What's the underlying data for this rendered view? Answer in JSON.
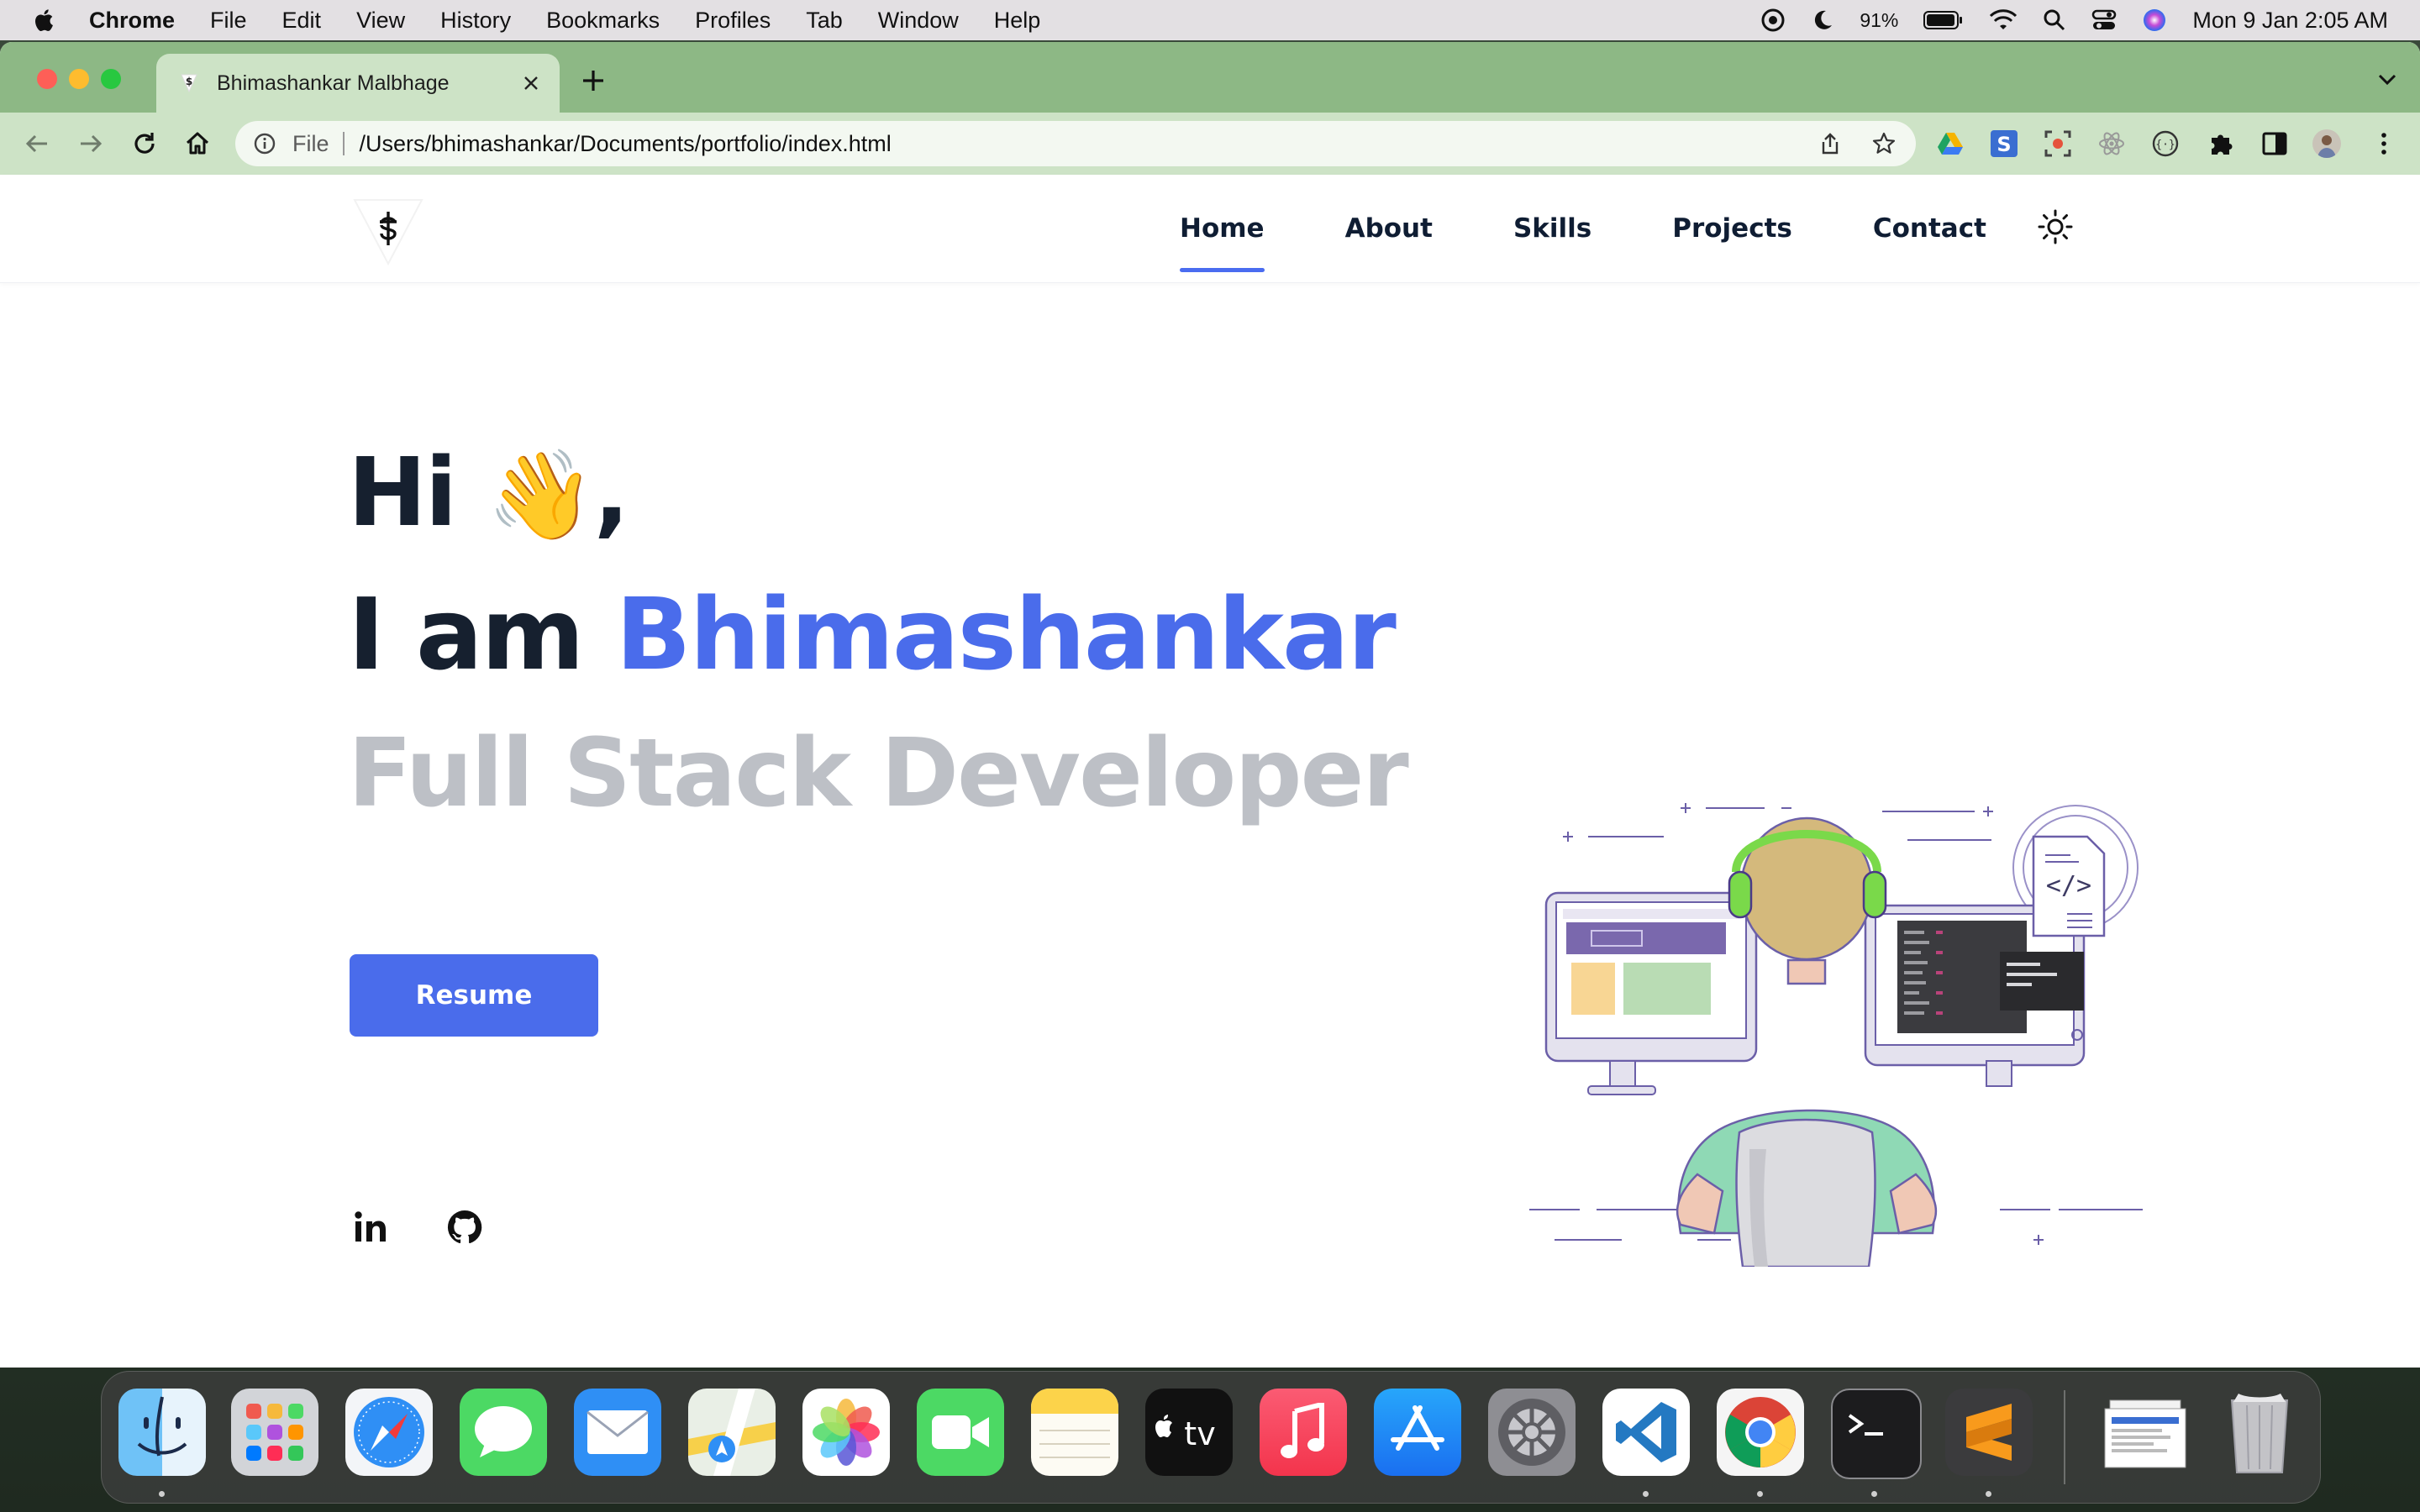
{
  "menubar": {
    "app": "Chrome",
    "items": [
      "File",
      "Edit",
      "View",
      "History",
      "Bookmarks",
      "Profiles",
      "Tab",
      "Window",
      "Help"
    ],
    "battery": "91%",
    "clock": "Mon 9 Jan  2:05 AM"
  },
  "browser": {
    "tab_title": "Bhimashankar Malbhage",
    "url_scheme": "File",
    "url": "/Users/bhimashankar/Documents/portfolio/index.html"
  },
  "site": {
    "nav": {
      "home": "Home",
      "about": "About",
      "skills": "Skills",
      "projects": "Projects",
      "contact": "Contact",
      "active": "Home"
    },
    "hero": {
      "greeting": "Hi",
      "wave": "👋",
      "comma": ",",
      "intro": "I am",
      "name": "Bhimashankar",
      "role": "Full Stack Developer",
      "resume_button": "Resume"
    },
    "social": [
      "linkedin-icon",
      "github-icon"
    ],
    "colors": {
      "accent": "#4a6ceb",
      "heading": "#16202f",
      "muted": "#bdc0c6"
    }
  },
  "dock": {
    "apps": [
      "Finder",
      "Launchpad",
      "Safari",
      "Messages",
      "Mail",
      "Maps",
      "Photos",
      "FaceTime",
      "Notes",
      "TV",
      "Music",
      "App Store",
      "System Preferences",
      "Visual Studio Code",
      "Google Chrome",
      "Terminal",
      "Sublime Text",
      "Downloads",
      "Trash"
    ]
  }
}
